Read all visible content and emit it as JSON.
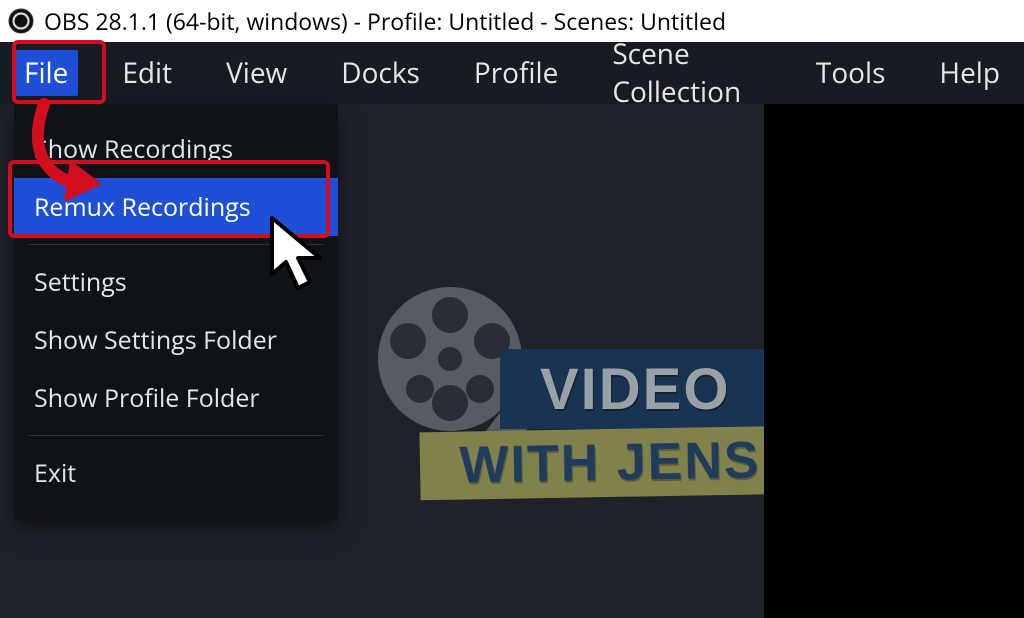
{
  "title": "OBS 28.1.1 (64-bit, windows) - Profile: Untitled - Scenes: Untitled",
  "menubar": {
    "file": "File",
    "edit": "Edit",
    "view": "View",
    "docks": "Docks",
    "profile": "Profile",
    "scenecol": "Scene Collection",
    "tools": "Tools",
    "help": "Help",
    "active": "file"
  },
  "file_menu": {
    "show_recordings": "Show Recordings",
    "remux": "Remux Recordings",
    "settings": "Settings",
    "show_settings_folder": "Show Settings Folder",
    "show_profile_folder": "Show Profile Folder",
    "exit": "Exit",
    "highlight": "remux"
  },
  "logo": {
    "line1": "VIDEO",
    "line2": "WITH JENS"
  },
  "annotations": {
    "file_box": true,
    "remux_box": true,
    "arrow": true,
    "cursor": true
  },
  "colors": {
    "accent": "#1f4fd6",
    "highlight_border": "#d30c1e",
    "menubar_bg": "#181b22",
    "dropdown_bg": "#0f1217",
    "preview_bg": "#1f2229"
  }
}
